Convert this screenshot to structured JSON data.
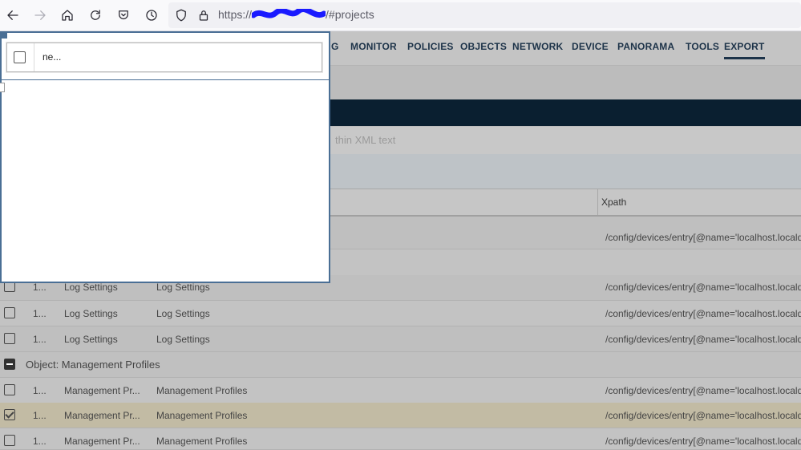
{
  "browser": {
    "url_scheme": "https://",
    "url_path": "/#projects",
    "icons": [
      "back-arrow-icon",
      "forward-arrow-icon",
      "home-icon",
      "reload-icon",
      "pocket-icon",
      "history-icon",
      "shield-icon",
      "lock-icon"
    ]
  },
  "nav": {
    "items": [
      {
        "label": "G"
      },
      {
        "label": "MONITOR"
      },
      {
        "label": "POLICIES"
      },
      {
        "label": "OBJECTS"
      },
      {
        "label": "NETWORK"
      },
      {
        "label": "DEVICE"
      },
      {
        "label": "PANORAMA"
      },
      {
        "label": "TOOLS"
      },
      {
        "label": "EXPORT"
      }
    ],
    "active": "EXPORT"
  },
  "search": {
    "placeholder_fragment": "thin XML text"
  },
  "table": {
    "xpath_header": "Xpath",
    "rows": [
      {
        "type": "item",
        "id": "",
        "name": "",
        "category": "",
        "xpath": "/config/devices/entry[@name='localhost.localdo"
      },
      {
        "type": "item",
        "id": "1...",
        "name": "Log Settings",
        "category": "Log Settings",
        "xpath": "/config/devices/entry[@name='localhost.localdo"
      },
      {
        "type": "item",
        "id": "1...",
        "name": "Log Settings",
        "category": "Log Settings",
        "xpath": "/config/devices/entry[@name='localhost.localdo"
      },
      {
        "type": "item",
        "id": "1...",
        "name": "Log Settings",
        "category": "Log Settings",
        "xpath": "/config/devices/entry[@name='localhost.localdo"
      },
      {
        "type": "group",
        "label": "Object: Management Profiles"
      },
      {
        "type": "item",
        "id": "1...",
        "name": "Management Pr...",
        "category": "Management Profiles",
        "xpath": "/config/devices/entry[@name='localhost.localdo"
      },
      {
        "type": "item",
        "id": "1...",
        "name": "Management Pr...",
        "category": "Management Profiles",
        "xpath": "/config/devices/entry[@name='localhost.localdo",
        "checked": true
      },
      {
        "type": "item",
        "id": "1...",
        "name": "Management Pr...",
        "category": "Management Profiles",
        "xpath": "/config/devices/entry[@name='localhost.localdo"
      }
    ]
  },
  "popup": {
    "field_text": "ne..."
  },
  "colors": {
    "nav_text": "#1d3349",
    "dark_bar": "#0a1f30",
    "popup_border": "#4a6f95",
    "redaction": "#1a1aff"
  }
}
